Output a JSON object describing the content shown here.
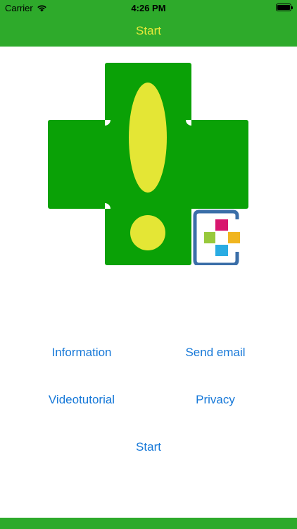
{
  "status_bar": {
    "carrier": "Carrier",
    "time": "4:26 PM",
    "wifi_icon": "wifi-icon",
    "battery_icon": "battery-icon",
    "battery_level": 1.0
  },
  "nav": {
    "title": "Start"
  },
  "logo": {
    "icon": "pharmacy-cross-exclamation-logo",
    "badge_icon": "app-badge-icon",
    "colors": {
      "cross": "#0aa106",
      "exclamation": "#e4e635",
      "badge_frame": "#3a6ea8",
      "badge_magenta": "#d8166e",
      "badge_green": "#98c93c",
      "badge_yellow": "#f0b51f",
      "badge_cyan": "#2aace3"
    }
  },
  "menu": {
    "information": "Information",
    "send_email": "Send email",
    "videotutorial": "Videotutorial",
    "privacy": "Privacy",
    "start": "Start"
  },
  "colors": {
    "bar_green": "#2eaa2b",
    "title_yellow": "#e6e83a",
    "link_blue": "#1678d8"
  }
}
